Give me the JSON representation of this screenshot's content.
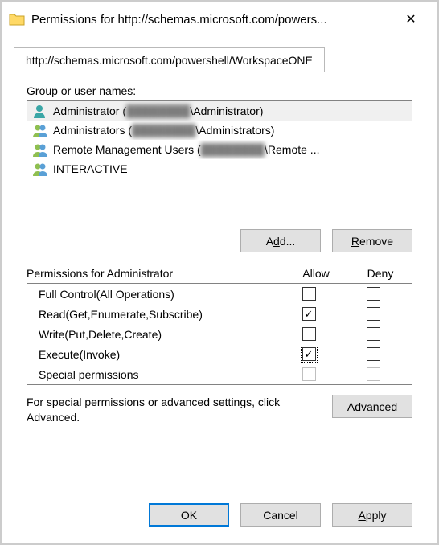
{
  "window": {
    "title": "Permissions for http://schemas.microsoft.com/powers...",
    "close_label": "✕"
  },
  "tab": {
    "label": "http://schemas.microsoft.com/powershell/WorkspaceONE"
  },
  "groups": {
    "label_pre": "G",
    "label_ul": "r",
    "label_post": "oup or user names:",
    "items": [
      {
        "icon": "single",
        "text": "Administrator (████████\\Administrator)",
        "selected": true
      },
      {
        "icon": "multi",
        "text": "Administrators (████████████\\Administrators)",
        "selected": false
      },
      {
        "icon": "multi",
        "text": "Remote Management Users (████████████\\Remote ...",
        "selected": false
      },
      {
        "icon": "multi",
        "text": "INTERACTIVE",
        "selected": false
      }
    ]
  },
  "buttons": {
    "add_pre": "A",
    "add_ul": "d",
    "add_post": "d...",
    "remove_ul": "R",
    "remove_post": "emove",
    "advanced_pre": "Ad",
    "advanced_ul": "v",
    "advanced_post": "anced",
    "ok": "OK",
    "cancel": "Cancel",
    "apply_ul": "A",
    "apply_post": "pply"
  },
  "perm": {
    "label_ul": "P",
    "label_post": "ermissions for Administrator",
    "col_allow": "Allow",
    "col_deny": "Deny",
    "rows": [
      {
        "name": "Full Control(All Operations)",
        "allow": false,
        "deny": false,
        "focused": false,
        "disabled": false
      },
      {
        "name": "Read(Get,Enumerate,Subscribe)",
        "allow": true,
        "deny": false,
        "focused": false,
        "disabled": false
      },
      {
        "name": "Write(Put,Delete,Create)",
        "allow": false,
        "deny": false,
        "focused": false,
        "disabled": false
      },
      {
        "name": "Execute(Invoke)",
        "allow": true,
        "deny": false,
        "focused": true,
        "disabled": false
      },
      {
        "name": "Special permissions",
        "allow": false,
        "deny": false,
        "focused": false,
        "disabled": true
      }
    ]
  },
  "hint": "For special permissions or advanced settings, click Advanced."
}
